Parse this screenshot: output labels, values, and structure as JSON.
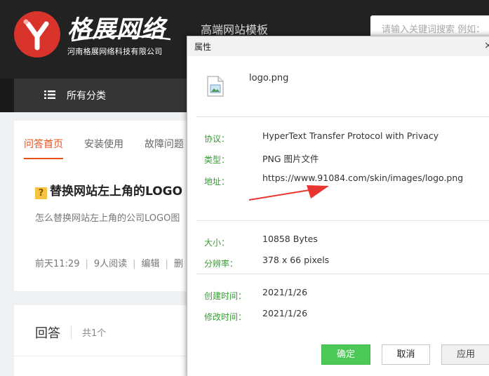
{
  "header": {
    "logo_letter": "Y",
    "brand_name": "格展网络",
    "brand_subtitle": "河南格展网络科技有限公司",
    "slogan": "高端网站模板",
    "search_placeholder": "请输入关键词搜索 例如：",
    "colors": {
      "bg": "#222222",
      "logo_red": "#d9342b"
    }
  },
  "nav": {
    "all_categories": "所有分类",
    "icon": "list-icon"
  },
  "question": {
    "tabs": [
      "问答首页",
      "安装使用",
      "故障问题"
    ],
    "active_tab": 0,
    "badge": "?",
    "title": "替换网站左上角的LOGO",
    "description": "怎么替换网站左上角的公司LOGO图",
    "meta": {
      "time": "前天11:29",
      "reads": "9人阅读",
      "edit": "编辑",
      "more": "删"
    }
  },
  "answers": {
    "title": "回答",
    "count": "共1个"
  },
  "dialog": {
    "title": "属性",
    "close": "×",
    "file_icon": "image-file-icon",
    "file_name": "logo.png",
    "rows": {
      "protocol": {
        "label": "协议：",
        "value": "HyperText Transfer Protocol with Privacy"
      },
      "type": {
        "label": "类型：",
        "value": "PNG 图片文件"
      },
      "address": {
        "label": "地址：",
        "value": "https://www.91084.com/skin/images/logo.png"
      },
      "size": {
        "label": "大小：",
        "value": "10858 Bytes"
      },
      "resolution": {
        "label": "分辨率：",
        "value": "378 x 66 pixels"
      },
      "created": {
        "label": "创建时间：",
        "value": "2021/1/26"
      },
      "modified": {
        "label": "修改时间：",
        "value": "2021/1/26"
      }
    },
    "buttons": {
      "ok": "确定",
      "cancel": "取消",
      "apply": "应用"
    },
    "colors": {
      "label_green": "#3a9a36",
      "ok_green": "#4cc857",
      "arrow_red": "#e8352f"
    }
  }
}
